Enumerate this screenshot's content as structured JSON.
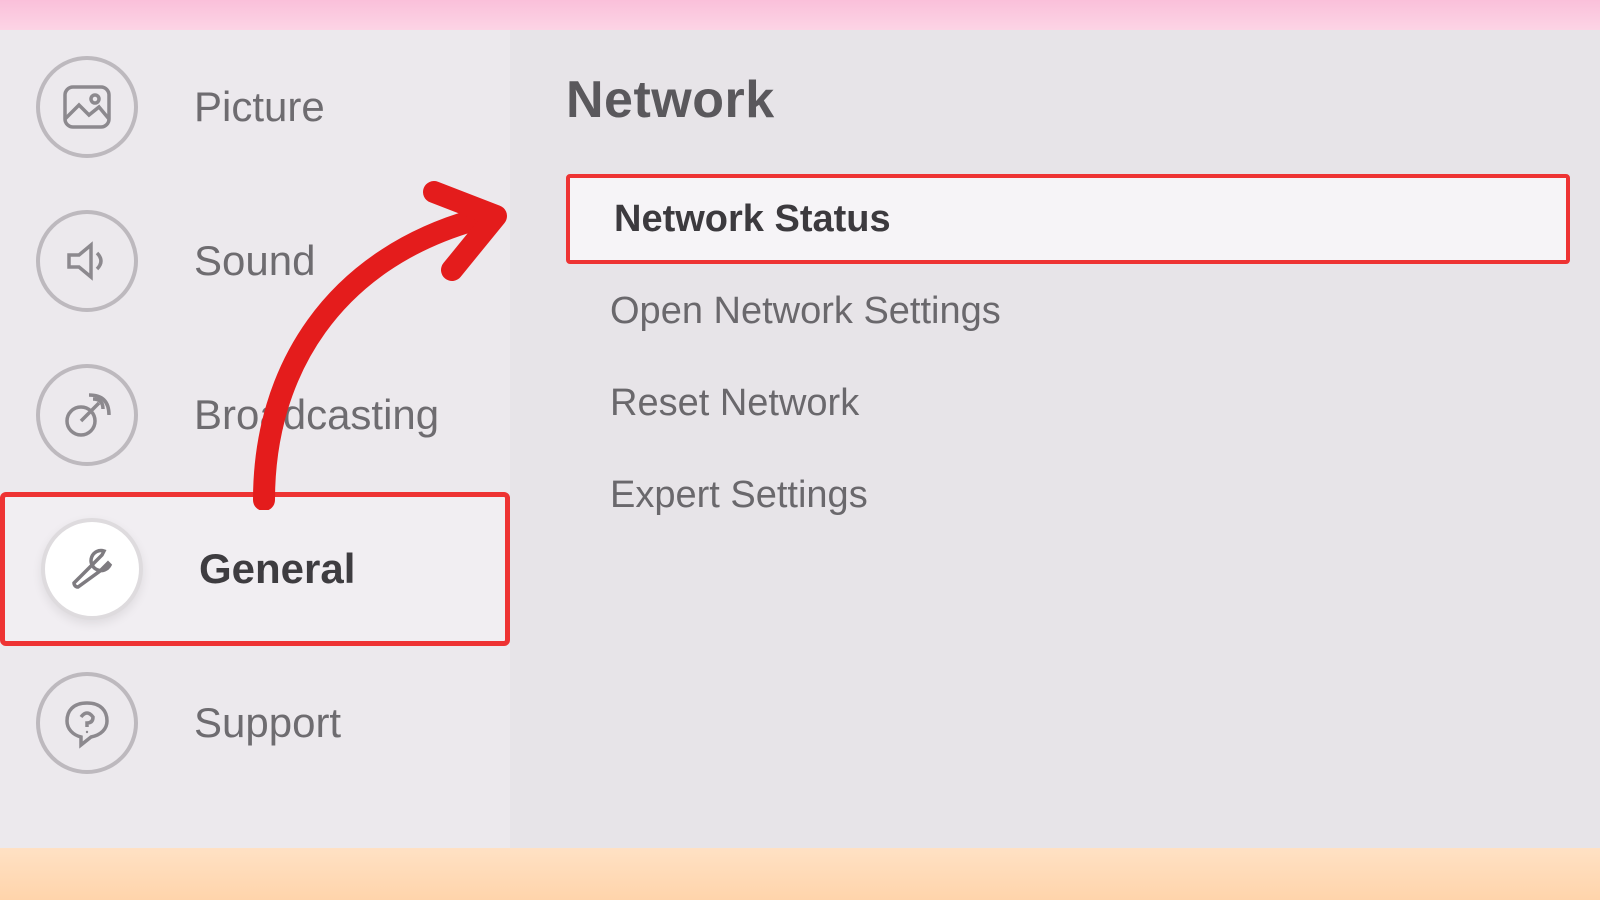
{
  "sidebar": {
    "items": [
      {
        "id": "picture",
        "label": "Picture",
        "icon": "picture-icon",
        "selected": false
      },
      {
        "id": "sound",
        "label": "Sound",
        "icon": "sound-icon",
        "selected": false
      },
      {
        "id": "broadcasting",
        "label": "Broadcasting",
        "icon": "broadcast-icon",
        "selected": false
      },
      {
        "id": "general",
        "label": "General",
        "icon": "wrench-icon",
        "selected": true
      },
      {
        "id": "support",
        "label": "Support",
        "icon": "support-icon",
        "selected": false
      }
    ]
  },
  "main": {
    "title": "Network",
    "options": [
      {
        "id": "network-status",
        "label": "Network  Status",
        "selected": true
      },
      {
        "id": "open-network-settings",
        "label": "Open Network  Settings",
        "selected": false
      },
      {
        "id": "reset-network",
        "label": "Reset Network",
        "selected": false
      },
      {
        "id": "expert-settings",
        "label": "Expert Settings",
        "selected": false
      }
    ]
  },
  "annotation": {
    "arrow_color": "#e41c1c"
  }
}
